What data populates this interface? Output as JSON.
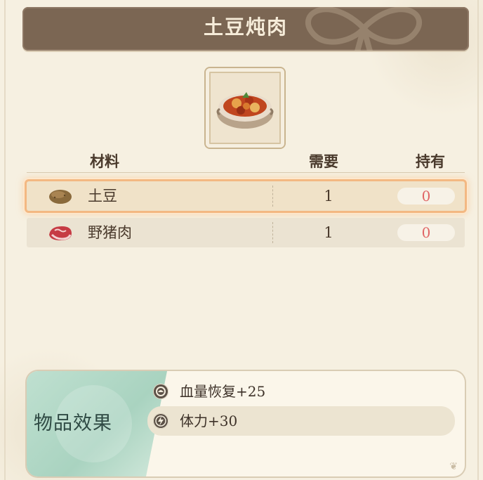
{
  "title": "土豆炖肉",
  "item_icon": "potato-stew-icon",
  "table": {
    "headers": {
      "material": "材料",
      "need": "需要",
      "have": "持有"
    },
    "rows": [
      {
        "icon": "potato-icon",
        "name": "土豆",
        "need": "1",
        "have": "0",
        "selected": true
      },
      {
        "icon": "boar-meat-icon",
        "name": "野猪肉",
        "need": "1",
        "have": "0",
        "selected": false
      }
    ]
  },
  "effects": {
    "label": "物品效果",
    "items": [
      {
        "icon": "health-icon",
        "text": "血量恢复+25"
      },
      {
        "icon": "stamina-lightning-icon",
        "text": "体力+30"
      }
    ]
  },
  "colors": {
    "title_bg": "#7b6653",
    "selected_glow": "#f3b882",
    "have_zero": "#e06565",
    "effect_green": "#a9d3c0"
  }
}
